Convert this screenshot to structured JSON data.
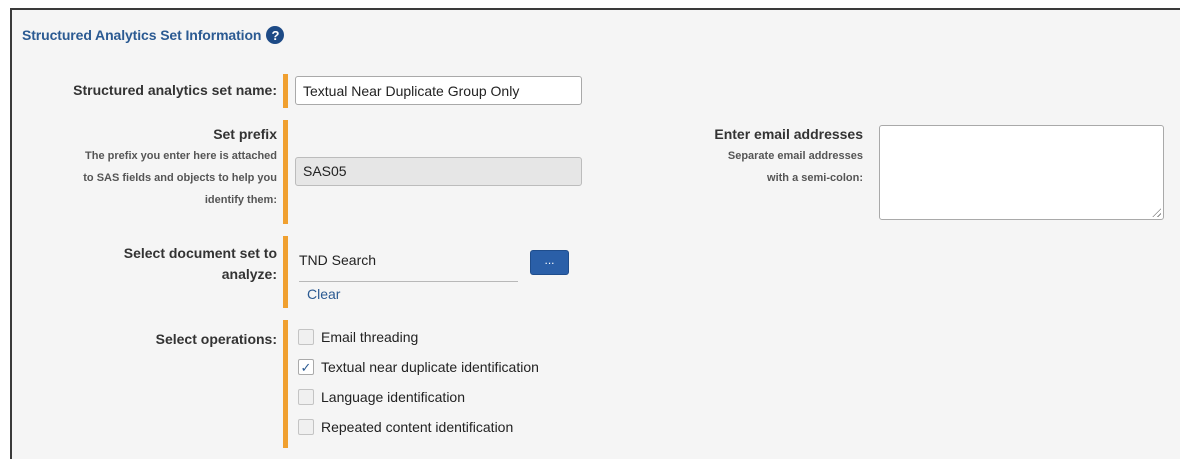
{
  "section": {
    "title": "Structured Analytics Set Information",
    "help_icon": "?"
  },
  "set_name": {
    "label": "Structured analytics set name:",
    "value": "Textual Near Duplicate Group Only"
  },
  "set_prefix": {
    "label": "Set prefix",
    "help_line1": "The prefix you enter here is attached",
    "help_line2": "to SAS fields and objects to help you",
    "help_line3": "identify them:",
    "value": "SAS05"
  },
  "email": {
    "label": "Enter email addresses",
    "help_line1": "Separate email addresses",
    "help_line2": "with a semi-colon:",
    "value": ""
  },
  "document_set": {
    "label_line1": "Select document set to",
    "label_line2": "analyze:",
    "value": "TND Search",
    "browse_label": "...",
    "clear_label": "Clear"
  },
  "operations": {
    "label": "Select operations:",
    "items": [
      {
        "label": "Email threading",
        "checked": false,
        "mark": ""
      },
      {
        "label": "Textual near duplicate identification",
        "checked": true,
        "mark": "✓"
      },
      {
        "label": "Language identification",
        "checked": false,
        "mark": ""
      },
      {
        "label": "Repeated content identification",
        "checked": false,
        "mark": ""
      }
    ]
  },
  "colors": {
    "required_bar": "#f0a030",
    "accent": "#2b5a92",
    "button": "#2a5fa8"
  }
}
